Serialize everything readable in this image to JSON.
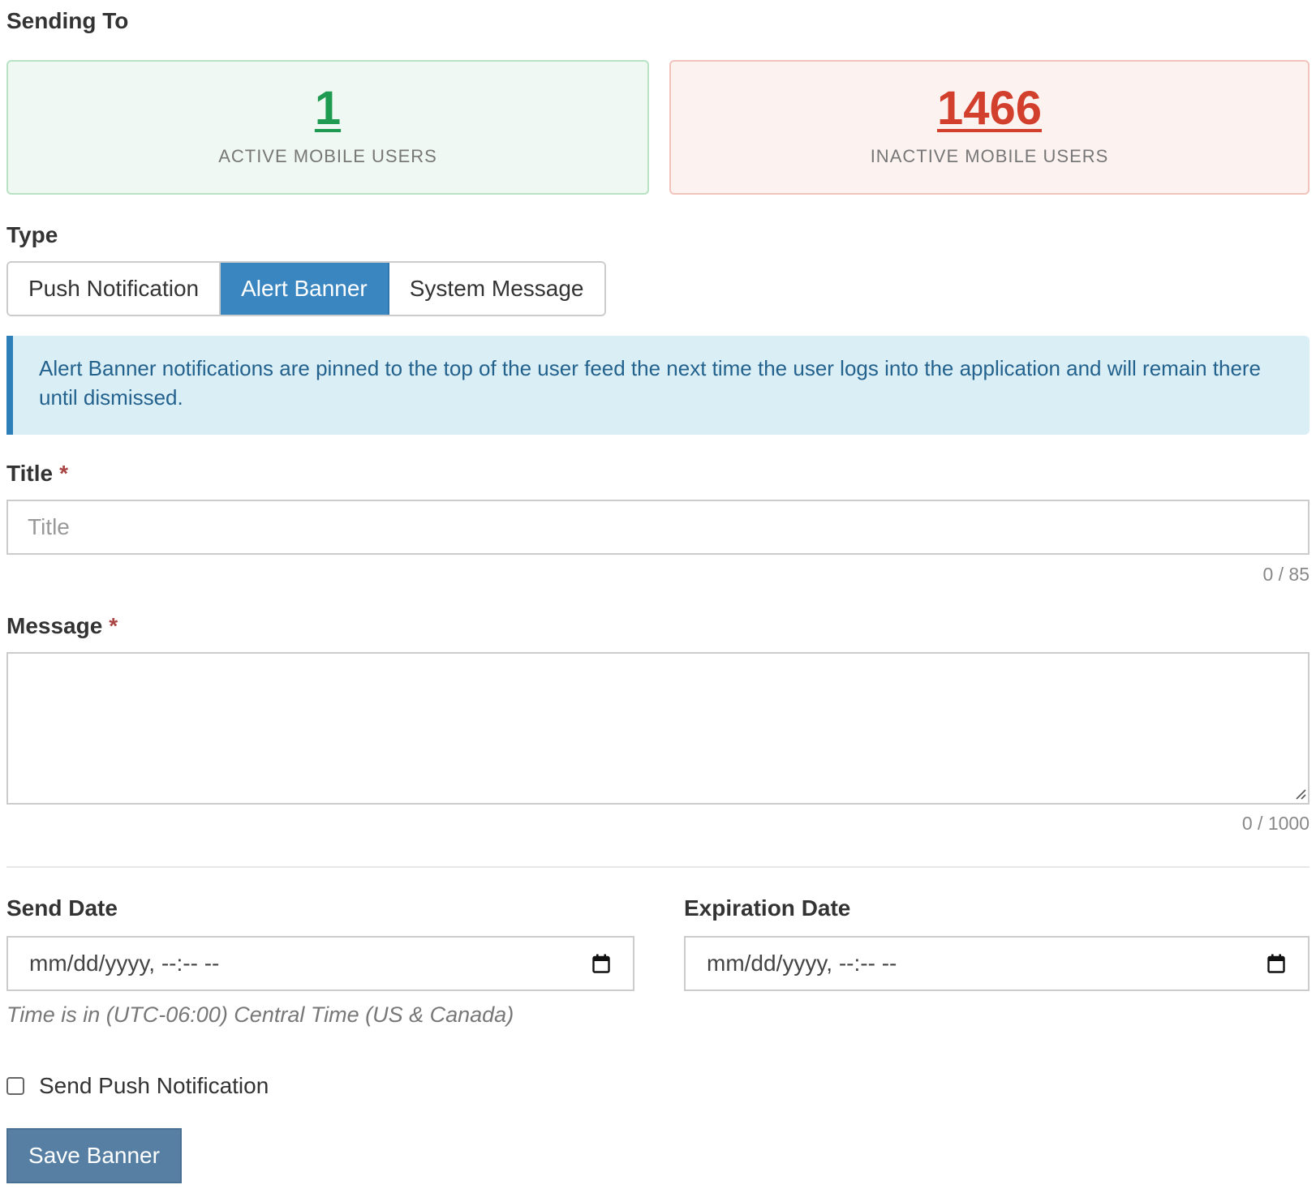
{
  "sending_to": {
    "label": "Sending To",
    "active": {
      "count": "1",
      "caption": "ACTIVE MOBILE USERS",
      "color": "#1e9a51"
    },
    "inactive": {
      "count": "1466",
      "caption": "INACTIVE MOBILE USERS",
      "color": "#d23f2c"
    }
  },
  "type": {
    "label": "Type",
    "options": [
      {
        "label": "Push Notification",
        "selected": false
      },
      {
        "label": "Alert Banner",
        "selected": true
      },
      {
        "label": "System Message",
        "selected": false
      }
    ]
  },
  "info_banner": {
    "text": "Alert Banner notifications are pinned to the top of the user feed the next time the user logs into the application and will remain there until dismissed."
  },
  "title_field": {
    "label": "Title",
    "required_mark": "*",
    "placeholder": "Title",
    "value": "",
    "counter": "0 / 85"
  },
  "message_field": {
    "label": "Message",
    "required_mark": "*",
    "value": "",
    "counter": "0 / 1000"
  },
  "send_date": {
    "label": "Send Date",
    "placeholder": "mm/dd/yyyy, --:-- --",
    "icon": "calendar-icon"
  },
  "expiration_date": {
    "label": "Expiration Date",
    "placeholder": "mm/dd/yyyy, --:-- --",
    "icon": "calendar-icon"
  },
  "timezone_hint": "Time is in (UTC-06:00) Central Time (US & Canada)",
  "send_push_checkbox": {
    "label": "Send Push Notification",
    "checked": false
  },
  "save_button": {
    "label": "Save Banner"
  },
  "colors": {
    "accent": "#3a86c0",
    "save_button": "#567fa3",
    "info_bg": "#daeef6",
    "required": "#a94442"
  }
}
